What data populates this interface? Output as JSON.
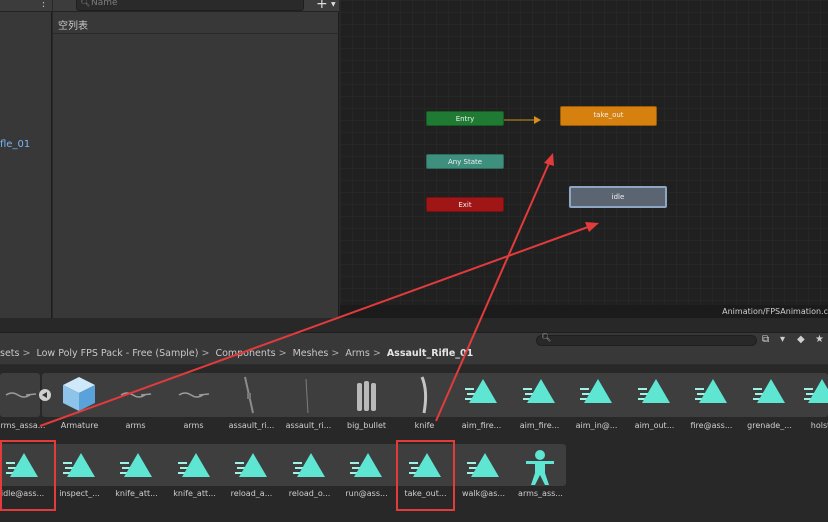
{
  "hierarchy": {
    "selected_label": "fle_01"
  },
  "parameters": {
    "search_placeholder": "Name",
    "empty_text": "空列表",
    "add_label": "+"
  },
  "graph": {
    "states": {
      "entry": "Entry",
      "any_state": "Any State",
      "exit": "Exit",
      "take_out": "take_out",
      "idle": "idle"
    },
    "footer_path": "Animation/FPSAnimation.c"
  },
  "project": {
    "search_placeholder": "",
    "breadcrumb": [
      "sets",
      "Low Poly FPS Pack - Free (Sample)",
      "Components",
      "Meshes",
      "Arms",
      "Assault_Rifle_01"
    ],
    "row1": [
      "arms_assa...",
      "Armature",
      "arms",
      "arms",
      "assault_ri...",
      "assault_ri...",
      "big_bullet",
      "knife",
      "aim_fire...",
      "aim_fire...",
      "aim_in@...",
      "aim_out...",
      "fire@ass...",
      "grenade_...",
      "holst"
    ],
    "row1_icons": [
      "mesh",
      "prefab",
      "mesh",
      "mesh",
      "rifle",
      "rifle-small",
      "bullets",
      "knife",
      "anim",
      "anim",
      "anim",
      "anim",
      "anim",
      "anim",
      "anim"
    ],
    "row2": [
      "idle@ass...",
      "inspect_...",
      "knife_att...",
      "knife_att...",
      "reload_a...",
      "reload_o...",
      "run@ass...",
      "take_out...",
      "walk@as...",
      "arms_ass..."
    ],
    "row2_icons": [
      "anim",
      "anim",
      "anim",
      "anim",
      "anim",
      "anim",
      "anim",
      "anim",
      "anim",
      "avatar"
    ]
  },
  "colors": {
    "anim_icon": "#5ee6d2",
    "annotation": "#e23b3b",
    "entry": "#1f7a33",
    "take_out": "#d6800f"
  }
}
